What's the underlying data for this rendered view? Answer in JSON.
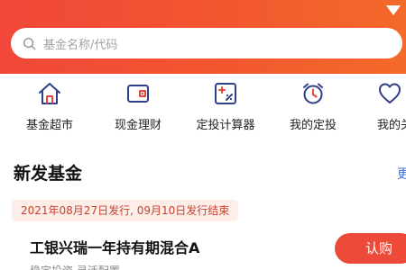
{
  "colors": {
    "brand_red": "#ee4a3a",
    "header_gradient_start": "#f0473a",
    "header_gradient_end": "#f36a2a",
    "link_blue": "#3d6fd6",
    "badge_bg": "#fdeeea",
    "badge_text": "#c8402e"
  },
  "search": {
    "placeholder": "基金名称/代码",
    "icon": "search-icon"
  },
  "quick_menu": [
    {
      "label": "基金超市",
      "icon": "house-icon"
    },
    {
      "label": "现金理财",
      "icon": "wallet-icon"
    },
    {
      "label": "定投计算器",
      "icon": "calculator-icon"
    },
    {
      "label": "我的定投",
      "icon": "alarm-clock-icon"
    },
    {
      "label": "我的关",
      "icon": "heart-icon"
    }
  ],
  "section": {
    "title": "新发基金",
    "more_label": "更"
  },
  "fund": {
    "date_info": "2021年08月27日发行, 09月10日发行结束",
    "name": "工银兴瑞一年持有期混合A",
    "sub_text": "稳定投资 灵活配置",
    "subscribe_label": "认购"
  }
}
